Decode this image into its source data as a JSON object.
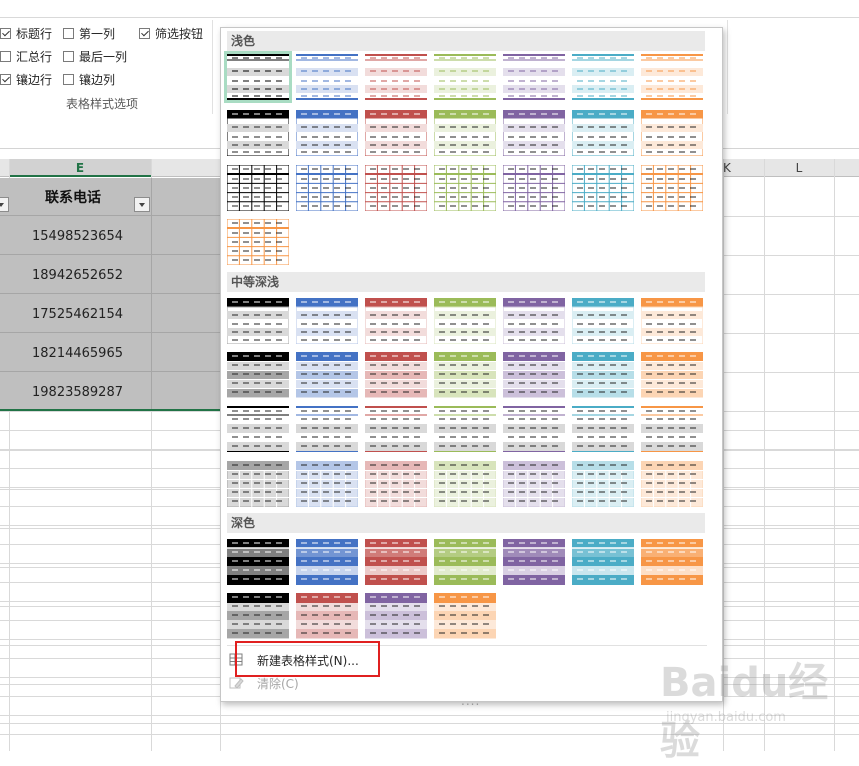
{
  "ribbon": {
    "options": [
      {
        "label": "标题行",
        "checked": true
      },
      {
        "label": "第一列",
        "checked": false
      },
      {
        "label": "筛选按钮",
        "checked": true
      },
      {
        "label": "汇总行",
        "checked": false
      },
      {
        "label": "最后一列",
        "checked": false
      },
      {
        "label": "镶边行",
        "checked": true
      },
      {
        "label": "镶边列",
        "checked": false
      }
    ],
    "group_label": "表格样式选项"
  },
  "sheet": {
    "columns": [
      {
        "label": "E",
        "selected": true
      },
      {
        "label": "K"
      },
      {
        "label": "L"
      }
    ],
    "table_header": "联系电话",
    "phones": [
      "15498523654",
      "18942652652",
      "17525462154",
      "18214465965",
      "19823589287"
    ]
  },
  "gallery": {
    "sections": [
      {
        "title": "浅色"
      },
      {
        "title": "中等深浅"
      },
      {
        "title": "深色"
      }
    ],
    "menu": {
      "new_style": "新建表格样式(N)...",
      "clear": "清除(C)"
    },
    "grip": "....",
    "palette": {
      "black": "#000000",
      "blue": "#4472c4",
      "red": "#c0504d",
      "green": "#9bbb59",
      "purple": "#8064a2",
      "teal": "#4bacc6",
      "orange": "#f79646",
      "selected_outline": "#a9dcc3"
    }
  },
  "watermark": {
    "text": "Baidu经验",
    "sub": "jingyan.baidu.com"
  }
}
